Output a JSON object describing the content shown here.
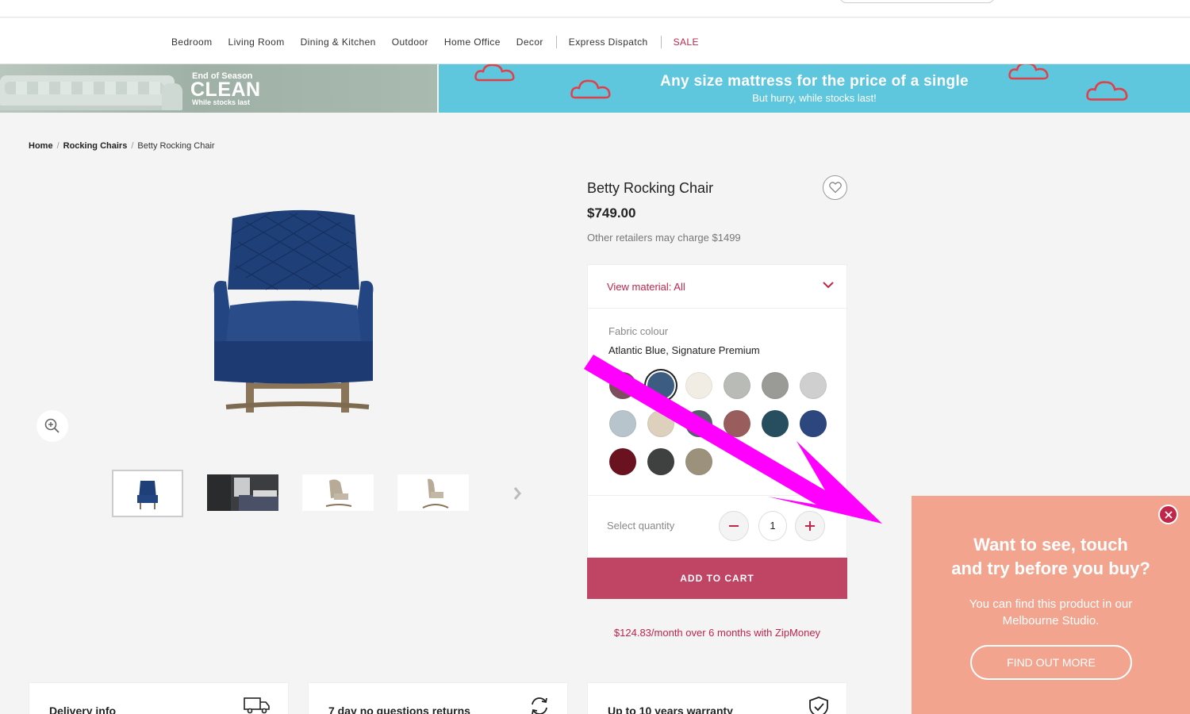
{
  "nav": {
    "items": [
      "Bedroom",
      "Living Room",
      "Dining & Kitchen",
      "Outdoor",
      "Home Office",
      "Decor"
    ],
    "express": "Express Dispatch",
    "sale": "SALE"
  },
  "banners": {
    "left": {
      "eyebrow": "End of Season",
      "headline": "CLEAN",
      "sub": "While stocks last"
    },
    "right": {
      "headline": "Any size mattress for the price of a single",
      "sub": "But hurry, while stocks last!"
    }
  },
  "breadcrumb": {
    "home": "Home",
    "category": "Rocking Chairs",
    "current": "Betty Rocking Chair"
  },
  "product": {
    "title": "Betty Rocking Chair",
    "price": "$749.00",
    "compare": "Other retailers may charge $1499",
    "material_select": "View material: All",
    "fabric_label": "Fabric colour",
    "fabric_value": "Atlantic Blue, Signature Premium",
    "quantity_label": "Select quantity",
    "quantity": "1",
    "add_to_cart": "ADD TO CART",
    "finance": "$124.83/month over 6 months with ZipMoney"
  },
  "swatches": [
    {
      "name": "swatch-plum",
      "color": "#7d4f5c"
    },
    {
      "name": "swatch-atlantic-blue",
      "color": "#3d5c82",
      "selected": true
    },
    {
      "name": "swatch-ivory",
      "color": "#f1ede4"
    },
    {
      "name": "swatch-silver",
      "color": "#b9bbb7"
    },
    {
      "name": "swatch-grey",
      "color": "#9a9a97"
    },
    {
      "name": "swatch-light-grey",
      "color": "#cfcfcf"
    },
    {
      "name": "swatch-sky",
      "color": "#b7c4cc"
    },
    {
      "name": "swatch-oatmeal",
      "color": "#ddd1bd"
    },
    {
      "name": "swatch-slate",
      "color": "#56616b"
    },
    {
      "name": "swatch-rose",
      "color": "#9a5d5d"
    },
    {
      "name": "swatch-teal",
      "color": "#274e5e"
    },
    {
      "name": "swatch-navy",
      "color": "#2c467e"
    },
    {
      "name": "swatch-burgundy",
      "color": "#6b1220"
    },
    {
      "name": "swatch-charcoal",
      "color": "#3f4040"
    },
    {
      "name": "swatch-taupe",
      "color": "#9c927c"
    }
  ],
  "info_cards": [
    "Delivery info",
    "7 day no questions returns",
    "Up to 10 years warranty"
  ],
  "popup": {
    "heading_line1": "Want to see, touch",
    "heading_line2": "and try before you buy?",
    "body": "You can find this product in our Melbourne Studio.",
    "button": "FIND OUT MORE"
  },
  "colors": {
    "accent": "#c04463",
    "popup": "#f2a48e",
    "banner": "#5ec6dd",
    "annotation_arrow": "#ff00ff"
  },
  "icons": [
    "heart-icon",
    "chevron-down-icon",
    "zoom-in-icon",
    "chevron-right-icon",
    "minus-icon",
    "plus-icon",
    "close-icon",
    "truck-icon",
    "refresh-icon",
    "shield-check-icon",
    "cloud-icon"
  ]
}
